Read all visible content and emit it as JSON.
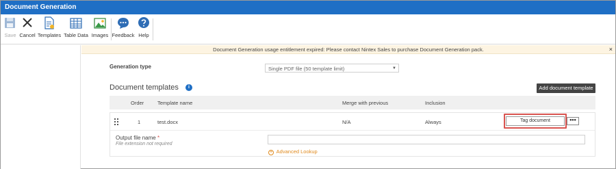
{
  "app": {
    "title": "Document Generation"
  },
  "ribbon": {
    "save": "Save",
    "cancel": "Cancel",
    "templates": "Templates",
    "table_data": "Table Data",
    "images": "Images",
    "feedback": "Feedback",
    "help": "Help"
  },
  "banner": {
    "message": "Document Generation usage entitlement expired: Please contact Nintex Sales to purchase Document Generation pack.",
    "close": "×"
  },
  "generation_type": {
    "label": "Generation type",
    "selected": "Single PDF file (50 template limit)",
    "arrow": "▼"
  },
  "templates_section": {
    "title": "Document templates",
    "info": "i",
    "add_button": "Add document template"
  },
  "table": {
    "columns": [
      "Order",
      "Template name",
      "Merge with previous",
      "Inclusion"
    ],
    "rows": [
      {
        "order": "1",
        "name": "test.docx",
        "merge": "N/A",
        "inclusion": "Always",
        "tag_button": "Tag document",
        "more_button": "•••"
      }
    ]
  },
  "output": {
    "label": "Output file name",
    "required_mark": "*",
    "hint": "File extension not required",
    "value": "",
    "advanced_lookup": "Advanced Lookup",
    "advanced_lookup_icon": "+"
  },
  "colors": {
    "titlebar": "#1f6fc5",
    "accent_orange": "#e08a1e",
    "highlight_red": "#d9534f",
    "banner_bg": "#fdf4e2"
  }
}
